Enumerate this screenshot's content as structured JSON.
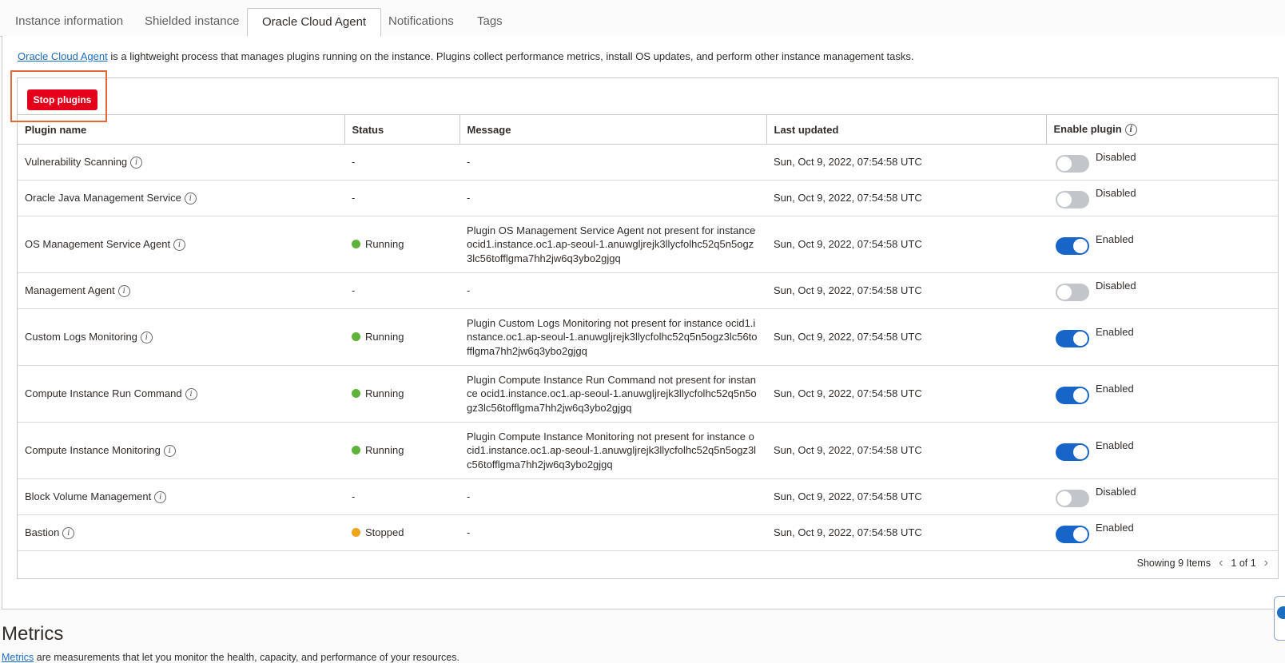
{
  "tabs": [
    {
      "label": "Instance information"
    },
    {
      "label": "Shielded instance"
    },
    {
      "label": "Oracle Cloud Agent"
    },
    {
      "label": "Notifications"
    },
    {
      "label": "Tags"
    }
  ],
  "intro": {
    "link": "Oracle Cloud Agent",
    "text": " is a lightweight process that manages plugins running on the instance. Plugins collect performance metrics, install OS updates, and perform other instance management tasks."
  },
  "toolbar": {
    "stop_label": "Stop plugins"
  },
  "table": {
    "headers": {
      "name": "Plugin name",
      "status": "Status",
      "message": "Message",
      "updated": "Last updated",
      "enable": "Enable plugin"
    },
    "rows": [
      {
        "name": "Vulnerability Scanning",
        "status": "-",
        "message": "-",
        "updated": "Sun, Oct 9, 2022, 07:54:58 UTC",
        "toggle": "Disabled"
      },
      {
        "name": "Oracle Java Management Service",
        "status": "-",
        "message": "-",
        "updated": "Sun, Oct 9, 2022, 07:54:58 UTC",
        "toggle": "Disabled"
      },
      {
        "name": "OS Management Service Agent",
        "status": "Running",
        "message": "Plugin OS Management Service Agent not present for instance ocid1.instance.oc1.ap-seoul-1.anuwgljrejk3llycfolhc52q5n5ogz3lc56tofflgma7hh2jw6q3ybo2gjgq",
        "updated": "Sun, Oct 9, 2022, 07:54:58 UTC",
        "toggle": "Enabled"
      },
      {
        "name": "Management Agent",
        "status": "-",
        "message": "-",
        "updated": "Sun, Oct 9, 2022, 07:54:58 UTC",
        "toggle": "Disabled"
      },
      {
        "name": "Custom Logs Monitoring",
        "status": "Running",
        "message": "Plugin Custom Logs Monitoring not present for instance ocid1.instance.oc1.ap-seoul-1.anuwgljrejk3llycfolhc52q5n5ogz3lc56tofflgma7hh2jw6q3ybo2gjgq",
        "updated": "Sun, Oct 9, 2022, 07:54:58 UTC",
        "toggle": "Enabled"
      },
      {
        "name": "Compute Instance Run Command",
        "status": "Running",
        "message": "Plugin Compute Instance Run Command not present for instance ocid1.instance.oc1.ap-seoul-1.anuwgljrejk3llycfolhc52q5n5ogz3lc56tofflgma7hh2jw6q3ybo2gjgq",
        "updated": "Sun, Oct 9, 2022, 07:54:58 UTC",
        "toggle": "Enabled"
      },
      {
        "name": "Compute Instance Monitoring",
        "status": "Running",
        "message": "Plugin Compute Instance Monitoring not present for instance ocid1.instance.oc1.ap-seoul-1.anuwgljrejk3llycfolhc52q5n5ogz3lc56tofflgma7hh2jw6q3ybo2gjgq",
        "updated": "Sun, Oct 9, 2022, 07:54:58 UTC",
        "toggle": "Enabled"
      },
      {
        "name": "Block Volume Management",
        "status": "-",
        "message": "-",
        "updated": "Sun, Oct 9, 2022, 07:54:58 UTC",
        "toggle": "Disabled"
      },
      {
        "name": "Bastion",
        "status": "Stopped",
        "message": "-",
        "updated": "Sun, Oct 9, 2022, 07:54:58 UTC",
        "toggle": "Enabled"
      }
    ]
  },
  "footer": {
    "showing": "Showing 9 Items",
    "page": "1 of 1"
  },
  "metrics": {
    "title": "Metrics",
    "link": "Metrics",
    "text": " are measurements that let you monitor the health, capacity, and performance of your resources."
  },
  "colors": {
    "running": "#5fb33a",
    "stopped": "#f0a41c",
    "danger": "#e4001b",
    "toggle_on": "#1765c9",
    "toggle_off": "#c2c6cb",
    "link": "#1b6ec2"
  },
  "icons": {
    "info": "info-circle-icon",
    "prev": "chevron-left-icon",
    "next": "chevron-right-icon"
  }
}
